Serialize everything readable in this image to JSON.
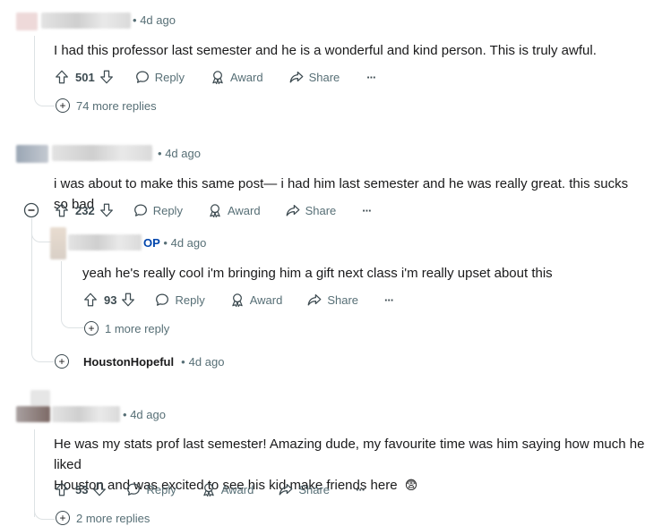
{
  "comments": [
    {
      "time": "4d ago",
      "body": "I had this professor last semester and he is a wonderful and kind person. This is truly awful.",
      "votes": "501",
      "more_replies": "74 more replies"
    },
    {
      "time": "4d ago",
      "body": "i was about to make this same post— i had him last semester and he was really great. this sucks so bad",
      "votes": "232",
      "reply": {
        "badge": "OP",
        "time": "4d ago",
        "body": "yeah he's really cool i'm bringing him a gift next class i'm really upset about this",
        "votes": "93",
        "more_replies": "1 more reply"
      },
      "collapsed_reply": {
        "username": "HoustonHopeful",
        "time": "4d ago"
      }
    },
    {
      "time": "4d ago",
      "body_line1": "He was my stats prof last semester! Amazing dude, my favourite time was him saying how much he liked",
      "body_line2": "Houston and was excited to see his kid make friends here",
      "emoji": "😨",
      "votes": "53",
      "more_replies": "2 more replies"
    }
  ],
  "actions": {
    "reply": "Reply",
    "award": "Award",
    "share": "Share",
    "overflow": "···"
  },
  "separator": "•",
  "colors": {
    "meta": "#576f76",
    "op": "#0045ac",
    "thread": "#dde2e4"
  },
  "icons": [
    "upvote-icon",
    "downvote-icon",
    "reply-icon",
    "award-icon",
    "share-icon",
    "more-icon",
    "expand-icon",
    "collapse-icon"
  ]
}
